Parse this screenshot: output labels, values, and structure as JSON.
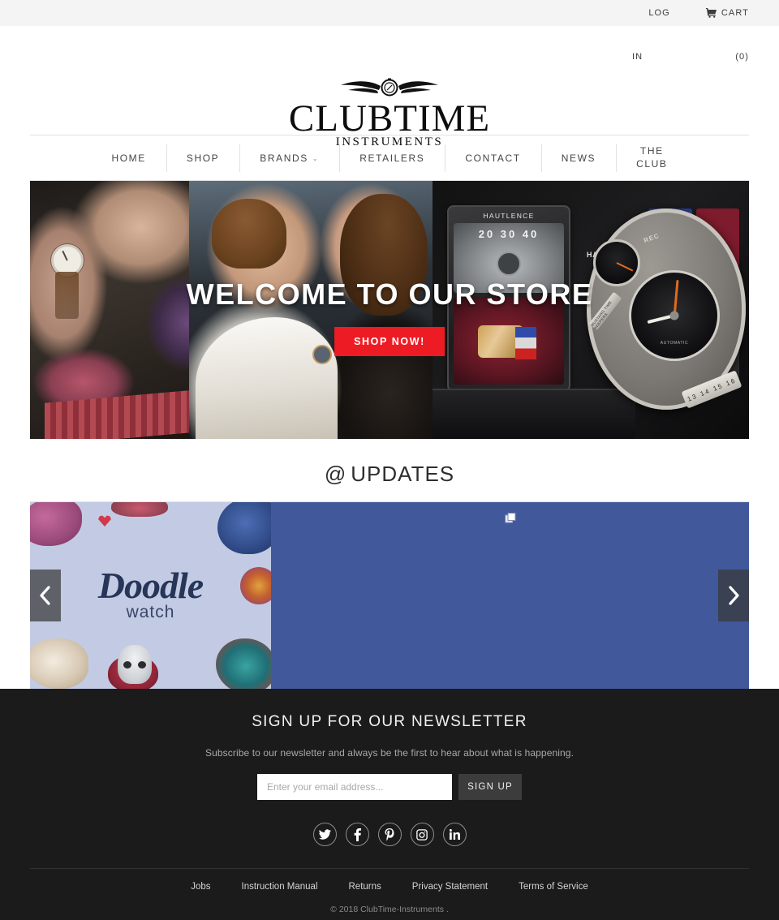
{
  "topbar": {
    "login_label": "LOG",
    "login_label_2": "IN",
    "cart_label": "CART",
    "cart_count": "(0)"
  },
  "logo": {
    "name": "CLUBTIME",
    "tagline": "INSTRUMENTS"
  },
  "nav": {
    "items": [
      {
        "label": "HOME",
        "has_caret": false
      },
      {
        "label": "SHOP",
        "has_caret": false
      },
      {
        "label": "BRANDS",
        "has_caret": true,
        "caret": "⌄"
      },
      {
        "label": "RETAILERS",
        "has_caret": false
      },
      {
        "label": "CONTACT",
        "has_caret": false
      },
      {
        "label": "NEWS",
        "has_caret": false
      }
    ],
    "the_club_line1": "THE",
    "the_club_line2": "CLUB"
  },
  "hero": {
    "title": "WELCOME TO OUR STORE",
    "cta_label": "SHOP NOW!",
    "cta_color": "#ed1c24",
    "watch_brand_label": "HAUTLENCE",
    "watch_dial_numbers": "20 30 40",
    "big_watch_automatic": "AUTOMATIC",
    "big_watch_rec": "REC",
    "big_watch_power": "HAUPOWER",
    "big_watch_tag": "MUSTANG TIME  KEEPERS",
    "big_watch_date": "13 14 15 16"
  },
  "updates": {
    "at_glyph": "@",
    "title": "UPDATES"
  },
  "carousel": {
    "slide_doodle_word": "Doodle",
    "slide_doodle_sub": "watch",
    "panel_color": "#41599b",
    "prev_label": "Previous slide",
    "next_label": "Next slide"
  },
  "newsletter": {
    "title": "SIGN UP FOR OUR NEWSLETTER",
    "subtitle": "Subscribe to our newsletter and always be the first to hear about what is happening.",
    "input_value": "",
    "input_placeholder": "Enter your email address...",
    "button_label": "SIGN UP"
  },
  "socials": [
    {
      "name": "twitter"
    },
    {
      "name": "facebook"
    },
    {
      "name": "pinterest"
    },
    {
      "name": "instagram"
    },
    {
      "name": "linkedin"
    }
  ],
  "footer": {
    "links": [
      {
        "label": "Jobs"
      },
      {
        "label": "Instruction Manual"
      },
      {
        "label": "Returns"
      },
      {
        "label": "Privacy Statement"
      },
      {
        "label": "Terms of Service"
      }
    ],
    "copyright": "© 2018   ClubTime-Instruments    ."
  }
}
